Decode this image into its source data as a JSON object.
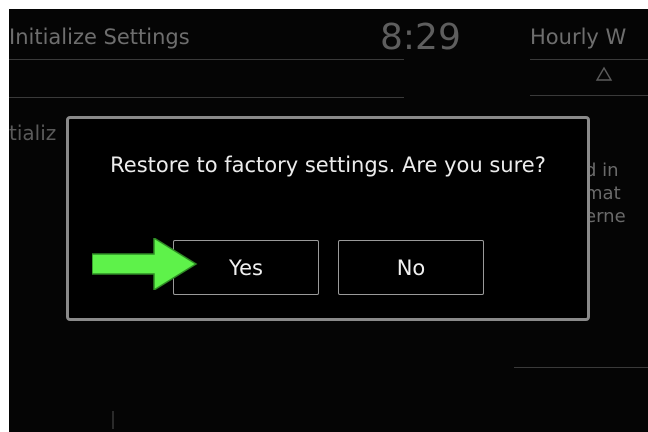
{
  "header": {
    "title": "Initialize Settings",
    "clock": "8:29",
    "right_label": "Hourly W",
    "up_arrow_icon": "triangle-up-icon"
  },
  "background": {
    "list_item_partial": "tializ",
    "desc_lines": "d in\nmat\nerne"
  },
  "dialog": {
    "message": "Restore to factory settings. Are you sure?",
    "yes_label": "Yes",
    "no_label": "No"
  },
  "annotation": {
    "pointer_icon": "green-arrow-icon",
    "color": "#5ef24a"
  }
}
